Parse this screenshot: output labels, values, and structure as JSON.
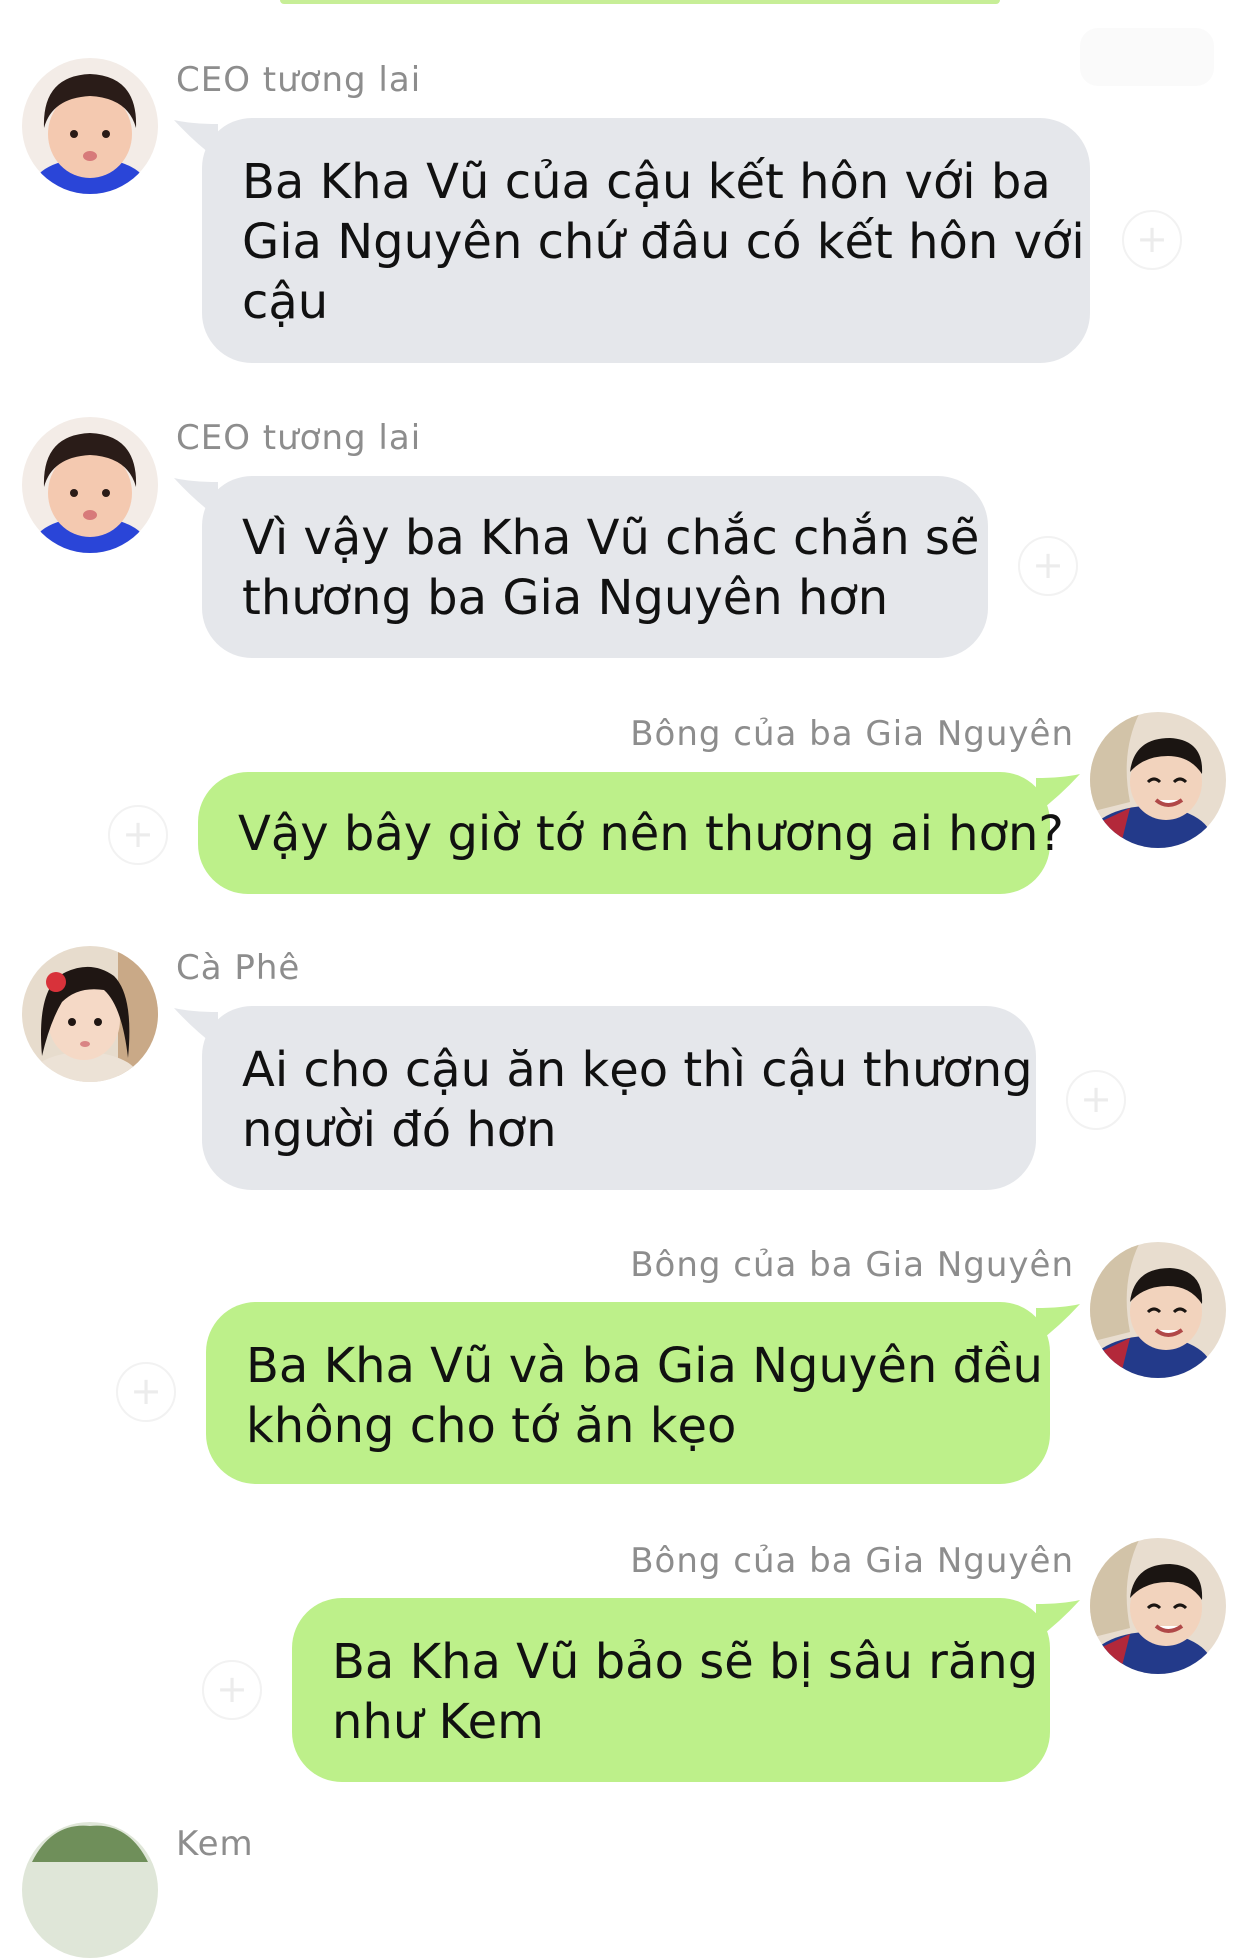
{
  "messages": [
    {
      "sender": "CEO tương lai",
      "lines": [
        "Ba Kha Vũ của cậu kết hôn với ba",
        "Gia Nguyên chứ đâu có kết hôn với",
        "cậu"
      ]
    },
    {
      "sender": "CEO tương lai",
      "lines": [
        "Vì vậy ba Kha Vũ chắc chắn sẽ",
        "thương ba Gia Nguyên hơn"
      ]
    },
    {
      "sender": "Bông của ba Gia Nguyên",
      "lines": [
        "Vậy bây giờ tớ nên thương ai hơn?"
      ]
    },
    {
      "sender": "Cà Phê",
      "lines": [
        "Ai cho cậu ăn kẹo thì cậu thương",
        "người đó hơn"
      ]
    },
    {
      "sender": "Bông của ba Gia Nguyên",
      "lines": [
        "Ba Kha Vũ và ba Gia Nguyên đều",
        "không cho tớ ăn kẹo"
      ]
    },
    {
      "sender": "Bông của ba Gia Nguyên",
      "lines": [
        "Ba Kha Vũ bảo sẽ bị sâu răng",
        "như Kem"
      ]
    },
    {
      "sender": "Kem",
      "lines": []
    }
  ],
  "react_icon": "add-reaction-icon",
  "react_glyph": "+",
  "colors": {
    "incoming_bubble": "#e5e7eb",
    "outgoing_bubble": "#bdf08a",
    "sender_name": "#8d8d8d"
  }
}
